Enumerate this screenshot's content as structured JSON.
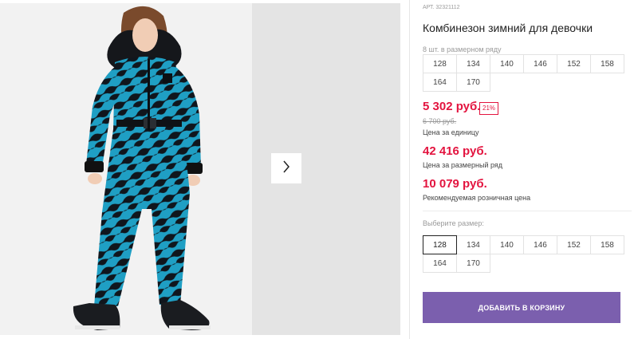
{
  "product": {
    "sku": "АРТ. 32321112",
    "title": "Комбинезон зимний для девочки",
    "image_alt": "girl-winter-jumpsuit-photo"
  },
  "gallery": {
    "next_icon": "chevron-right-icon"
  },
  "pack": {
    "note": "8 шт. в размерном ряду",
    "sizes": [
      "128",
      "134",
      "140",
      "146",
      "152",
      "158",
      "164",
      "170"
    ]
  },
  "prices": {
    "unit_price": "5 302 руб.",
    "discount": "21%",
    "old_price": "6 700 руб.",
    "unit_note": "Цена за единицу",
    "pack_price": "42 416 руб.",
    "pack_note": "Цена за размерный ряд",
    "rrp_price": "10 079 руб.",
    "rrp_note": "Рекомендуемая розничная цена"
  },
  "size_select": {
    "label": "Выберите размер:",
    "sizes": [
      "128",
      "134",
      "140",
      "146",
      "152",
      "158",
      "164",
      "170"
    ],
    "selected": "128"
  },
  "cart": {
    "button_label": "ДОБАВИТЬ В КОРЗИНУ"
  },
  "colors": {
    "price_red": "#e3143f",
    "button_purple": "#7b5fae",
    "jumpsuit_teal": "#1f9fc4"
  }
}
